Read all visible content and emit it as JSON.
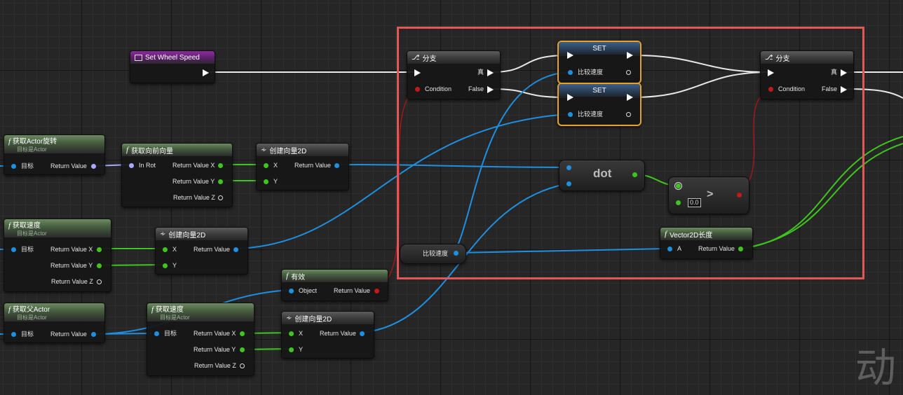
{
  "nodes": {
    "set_wheel_speed": {
      "title": "Set Wheel Speed"
    },
    "get_actor_rotation": {
      "title": "获取Actor旋转",
      "subtitle": "目标是Actor",
      "in": "目标",
      "out": "Return Value"
    },
    "get_forward_vector": {
      "title": "获取向前向量",
      "in": "In Rot",
      "out_x": "Return Value X",
      "out_y": "Return Value Y",
      "out_z": "Return Value Z"
    },
    "make_vector2d_1": {
      "title": "创建向量2D",
      "in_x": "X",
      "in_y": "Y",
      "out": "Return Value"
    },
    "get_velocity_1": {
      "title": "获取速度",
      "subtitle": "目标是Actor",
      "in": "目标",
      "out_x": "Return Value X",
      "out_y": "Return Value Y",
      "out_z": "Return Value Z"
    },
    "make_vector2d_2": {
      "title": "创建向量2D",
      "in_x": "X",
      "in_y": "Y",
      "out": "Return Value"
    },
    "is_valid": {
      "title": "有效",
      "in": "Object",
      "out": "Return Value"
    },
    "get_parent_actor": {
      "title": "获取父Actor",
      "subtitle": "目标是Actor",
      "in": "目标",
      "out": "Return Value"
    },
    "get_velocity_2": {
      "title": "获取速度",
      "subtitle": "目标是Actor",
      "in": "目标",
      "out_x": "Return Value X",
      "out_y": "Return Value Y",
      "out_z": "Return Value Z"
    },
    "make_vector2d_3": {
      "title": "创建向量2D",
      "in_x": "X",
      "in_y": "Y",
      "out": "Return Value"
    },
    "branch_1": {
      "title": "分支",
      "cond": "Condition",
      "true": "真",
      "false": "False"
    },
    "set_1": {
      "title": "SET",
      "var": "比较速度"
    },
    "set_2": {
      "title": "SET",
      "var": "比较速度"
    },
    "branch_2": {
      "title": "分支",
      "cond": "Condition",
      "true": "真",
      "false": "False"
    },
    "dot": {
      "title": "dot"
    },
    "greater": {
      "op": ">",
      "value": "0.0"
    },
    "compare_speed_var": {
      "label": "比较速度"
    },
    "vector2d_length": {
      "title": "Vector2D长度",
      "in": "A",
      "out": "Return Value"
    }
  },
  "watermark": "动",
  "colors": {
    "selection": "#e25757",
    "selected_node": "#e8a22a",
    "vector_pin": "#1f8fe0",
    "float_pin": "#3ec51e",
    "bool_pin": "#c21a1a",
    "rotator_pin": "#a6a8ff",
    "exec_pin": "#ffffff"
  }
}
